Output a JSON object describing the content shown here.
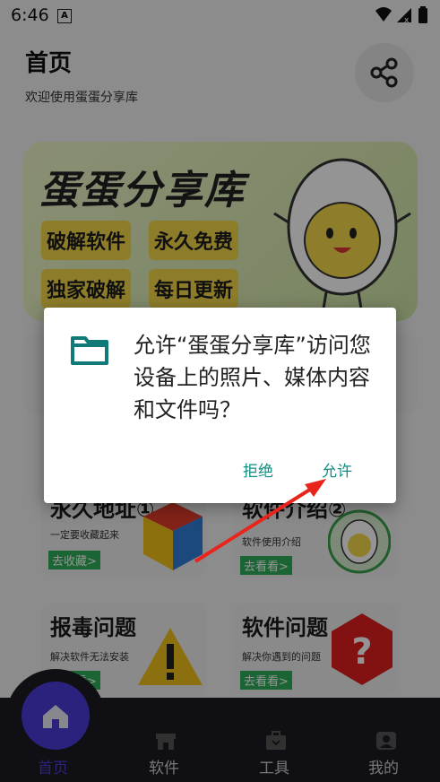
{
  "status": {
    "time": "6:46",
    "notif_letter": "A"
  },
  "header": {
    "title": "首页",
    "subtitle": "欢迎使用蛋蛋分享库"
  },
  "banner": {
    "title": "蛋蛋分享库",
    "tags": [
      "破解软件",
      "永久免费",
      "独家破解",
      "每日更新"
    ]
  },
  "cards": [
    {
      "title": "永久地址①",
      "desc": "一定要收藏起来",
      "btn": "去收藏>"
    },
    {
      "title": "软件介绍②",
      "desc": "软件使用介绍",
      "btn": "去看看>"
    },
    {
      "title": "报毒问题",
      "desc": "解决软件无法安装",
      "btn": "去看看>"
    },
    {
      "title": "软件问题",
      "desc": "解决你遇到的问题",
      "btn": "去看看>"
    }
  ],
  "dialog": {
    "message": "允许“蛋蛋分享库”访问您设备上的照片、媒体内容和文件吗？",
    "deny": "拒绝",
    "allow": "允许"
  },
  "nav": {
    "items": [
      {
        "label": "首页",
        "icon": "home-icon",
        "active": true
      },
      {
        "label": "软件",
        "icon": "store-icon",
        "active": false
      },
      {
        "label": "工具",
        "icon": "toolbox-icon",
        "active": false
      },
      {
        "label": "我的",
        "icon": "user-icon",
        "active": false
      }
    ]
  },
  "colors": {
    "accent": "#4b3bd8",
    "dialog_button": "#0f8f82",
    "nav_bg": "#1c1c23",
    "tag_bg": "#f3d84a",
    "card_btn": "#2fae5a"
  }
}
